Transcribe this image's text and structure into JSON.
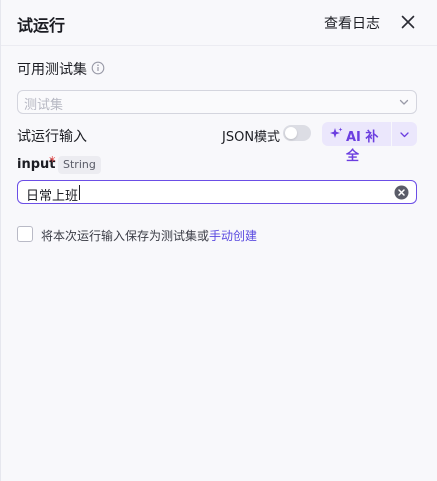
{
  "header": {
    "title": "试运行",
    "log_button": "查看日志"
  },
  "test_set": {
    "label": "可用测试集",
    "placeholder": "测试集"
  },
  "run_input": {
    "label": "试运行输入",
    "json_mode_label": "JSON模式",
    "json_mode_enabled": false,
    "ai_button_label": "AI 补全"
  },
  "field": {
    "name": "input",
    "required_mark": "*",
    "type": "String",
    "value": "日常上班"
  },
  "save": {
    "text": "将本次运行输入保存为测试集或",
    "link": "手动创建",
    "checked": false
  },
  "colors": {
    "accent": "#6b4ee6",
    "ai_bg": "#ebe7fc",
    "ai_text": "#6b3ee0",
    "link": "#5a4ae0",
    "required": "#e54b4b"
  }
}
